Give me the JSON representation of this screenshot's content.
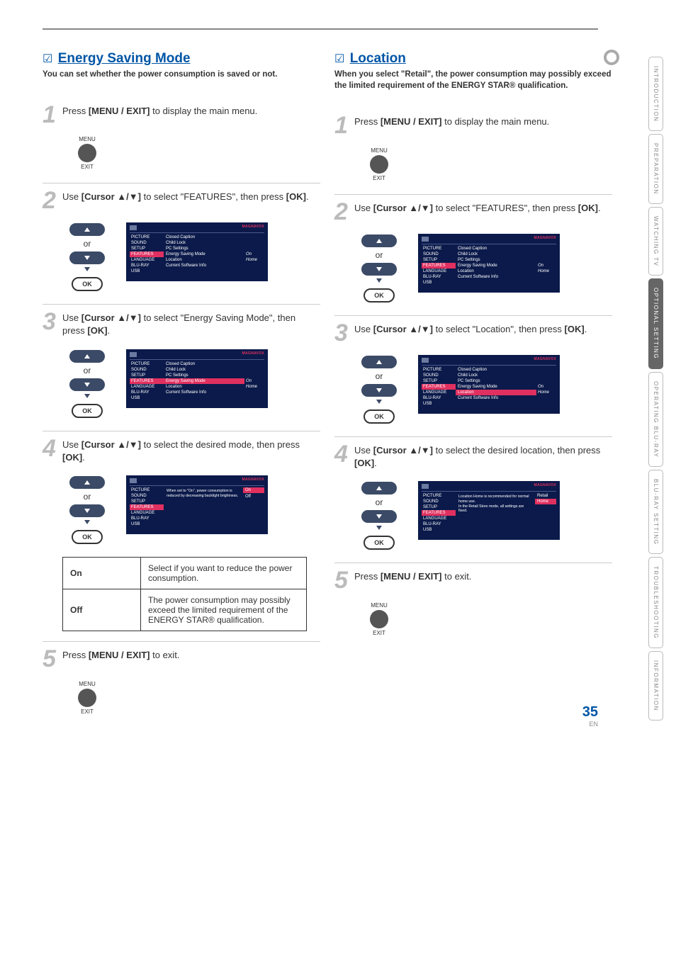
{
  "page": {
    "number": "35",
    "lang": "EN"
  },
  "tabs": [
    "INTRODUCTION",
    "PREPARATION",
    "WATCHING TV",
    "OPTIONAL SETTING",
    "OPERATING BLU-RAY",
    "BLU-RAY SETTING",
    "TROUBLESHOOTING",
    "INFORMATION"
  ],
  "left": {
    "title": "Energy Saving Mode",
    "sub": "You can set whether the power consumption is saved or not.",
    "s1": {
      "pre": "Press ",
      "b": "[MENU / EXIT]",
      "post": " to display the main menu.",
      "menu": "MENU",
      "exit": "EXIT"
    },
    "s2": {
      "pre": "Use ",
      "b": "[Cursor ▲/▼]",
      "mid": " to select \"FEATURES\", then press ",
      "b2": "[OK]",
      "post": ".",
      "or": "or",
      "ok": "OK"
    },
    "s3": {
      "pre": "Use ",
      "b": "[Cursor ▲/▼]",
      "mid": " to select \"Energy Saving Mode\", then press ",
      "b2": "[OK]",
      "post": ".",
      "or": "or",
      "ok": "OK"
    },
    "s4": {
      "pre": "Use ",
      "b": "[Cursor ▲/▼]",
      "mid": " to select the desired mode, then press ",
      "b2": "[OK]",
      "post": ".",
      "or": "or",
      "ok": "OK"
    },
    "s5": {
      "pre": "Press ",
      "b": "[MENU / EXIT]",
      "post": " to exit.",
      "menu": "MENU",
      "exit": "EXIT"
    },
    "osd_brand": "MAGNAVOX",
    "osd_side": [
      "PICTURE",
      "SOUND",
      "SETUP",
      "FEATURES",
      "LANGUAGE",
      "BLU-RAY",
      "USB"
    ],
    "osd2_opts": [
      "Closed Caption",
      "Child Lock",
      "PC Settings",
      "Energy Saving Mode",
      "Location",
      "Current Software Info"
    ],
    "osd2_vals": {
      "esm": "On",
      "loc": "Home"
    },
    "osd3_opts": [
      "Closed Caption",
      "Child Lock",
      "PC Settings",
      "Energy Saving Mode",
      "Location",
      "Current Software Info"
    ],
    "osd3_vals": {
      "esm": "On",
      "loc": "Home"
    },
    "osd4_vals": {
      "on": "On",
      "off": "Off"
    },
    "osd4_text": "When set to \"On\", power consumption is reduced by decreasing backlight brightness.",
    "table": {
      "on_k": "On",
      "on_v": "Select if you want to reduce the power consumption.",
      "off_k": "Off",
      "off_v": "The power consumption may possibly exceed the limited requirement of the ENERGY STAR® qualification."
    }
  },
  "right": {
    "title": "Location",
    "sub": "When you select \"Retail\", the power consumption may possibly exceed the limited requirement of the ENERGY STAR® qualification.",
    "s1": {
      "pre": "Press ",
      "b": "[MENU / EXIT]",
      "post": " to display the main menu.",
      "menu": "MENU",
      "exit": "EXIT"
    },
    "s2": {
      "pre": "Use ",
      "b": "[Cursor ▲/▼]",
      "mid": " to select \"FEATURES\", then press ",
      "b2": "[OK]",
      "post": ".",
      "or": "or",
      "ok": "OK"
    },
    "s3": {
      "pre": "Use ",
      "b": "[Cursor ▲/▼]",
      "mid": " to select \"Location\", then press ",
      "b2": "[OK]",
      "post": ".",
      "or": "or",
      "ok": "OK"
    },
    "s4": {
      "pre": "Use ",
      "b": "[Cursor ▲/▼]",
      "mid": " to select the desired location, then press ",
      "b2": "[OK]",
      "post": ".",
      "or": "or",
      "ok": "OK"
    },
    "s5": {
      "pre": "Press ",
      "b": "[MENU / EXIT]",
      "post": " to exit.",
      "menu": "MENU",
      "exit": "EXIT"
    },
    "osd_brand": "MAGNAVOX",
    "osd_side": [
      "PICTURE",
      "SOUND",
      "SETUP",
      "FEATURES",
      "LANGUAGE",
      "BLU-RAY",
      "USB"
    ],
    "osd2_opts": [
      "Closed Caption",
      "Child Lock",
      "PC Settings",
      "Energy Saving Mode",
      "Location",
      "Current Software Info"
    ],
    "osd2_vals": {
      "esm": "On",
      "loc": "Home"
    },
    "osd3_opts": [
      "Closed Caption",
      "Child Lock",
      "PC Settings",
      "Energy Saving Mode",
      "Location",
      "Current Software Info"
    ],
    "osd3_vals": {
      "esm": "On",
      "loc": "Home"
    },
    "osd4_vals": {
      "retail": "Retail",
      "home": "Home"
    },
    "osd4_text": "Location Home is recommended for normal home use.\nIn the Retail Store mode, all settings are fixed."
  }
}
